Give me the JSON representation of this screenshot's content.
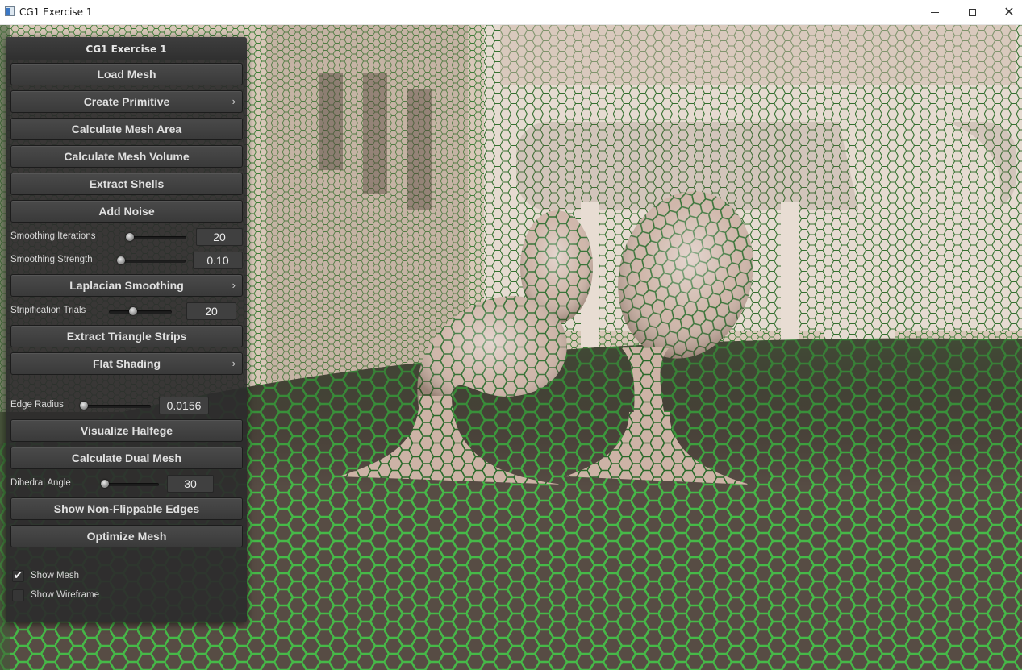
{
  "window": {
    "title": "CG1 Exercise 1",
    "controls": {
      "minimize": "minimize-icon",
      "maximize": "maximize-icon",
      "close": "close-icon"
    },
    "close_glyph": "✕"
  },
  "viewport": {
    "description_icon": "mesh-render",
    "colors": {
      "surface": "#d9cbbe",
      "edge": "#2f7a2f",
      "edge_highlight": "#7ee07a",
      "floor": "#5a4f46"
    }
  },
  "panel": {
    "title": "CG1 Exercise 1",
    "buttons": {
      "load_mesh": "Load Mesh",
      "create_primitive": "Create Primitive",
      "calc_area": "Calculate Mesh Area",
      "calc_volume": "Calculate Mesh Volume",
      "extract_shells": "Extract Shells",
      "add_noise": "Add Noise",
      "laplacian": "Laplacian Smoothing",
      "extract_strips": "Extract Triangle Strips",
      "flat_shading": "Flat Shading",
      "visualize_halfedge": "Visualize Halfege",
      "dual_mesh": "Calculate Dual Mesh",
      "non_flippable": "Show Non-Flippable Edges",
      "optimize": "Optimize Mesh"
    },
    "chevron": "›",
    "sliders": {
      "smoothing_iterations": {
        "label": "Smoothing Iterations",
        "value": "20",
        "level": 0.0
      },
      "smoothing_strength": {
        "label": "Smoothing Strength",
        "value": "0.10",
        "level": 0.0
      },
      "stripification_trials": {
        "label": "Stripification Trials",
        "value": "20",
        "level": 0.4
      },
      "edge_radius": {
        "label": "Edge Radius",
        "value": "0.0156",
        "level": 0.0
      },
      "dihedral_angle": {
        "label": "Dihedral Angle",
        "value": "30",
        "level": 0.0
      }
    },
    "checkboxes": {
      "show_mesh": {
        "label": "Show Mesh",
        "checked": true,
        "mark": "✔"
      },
      "show_wireframe": {
        "label": "Show Wireframe",
        "checked": false,
        "mark": ""
      }
    }
  }
}
